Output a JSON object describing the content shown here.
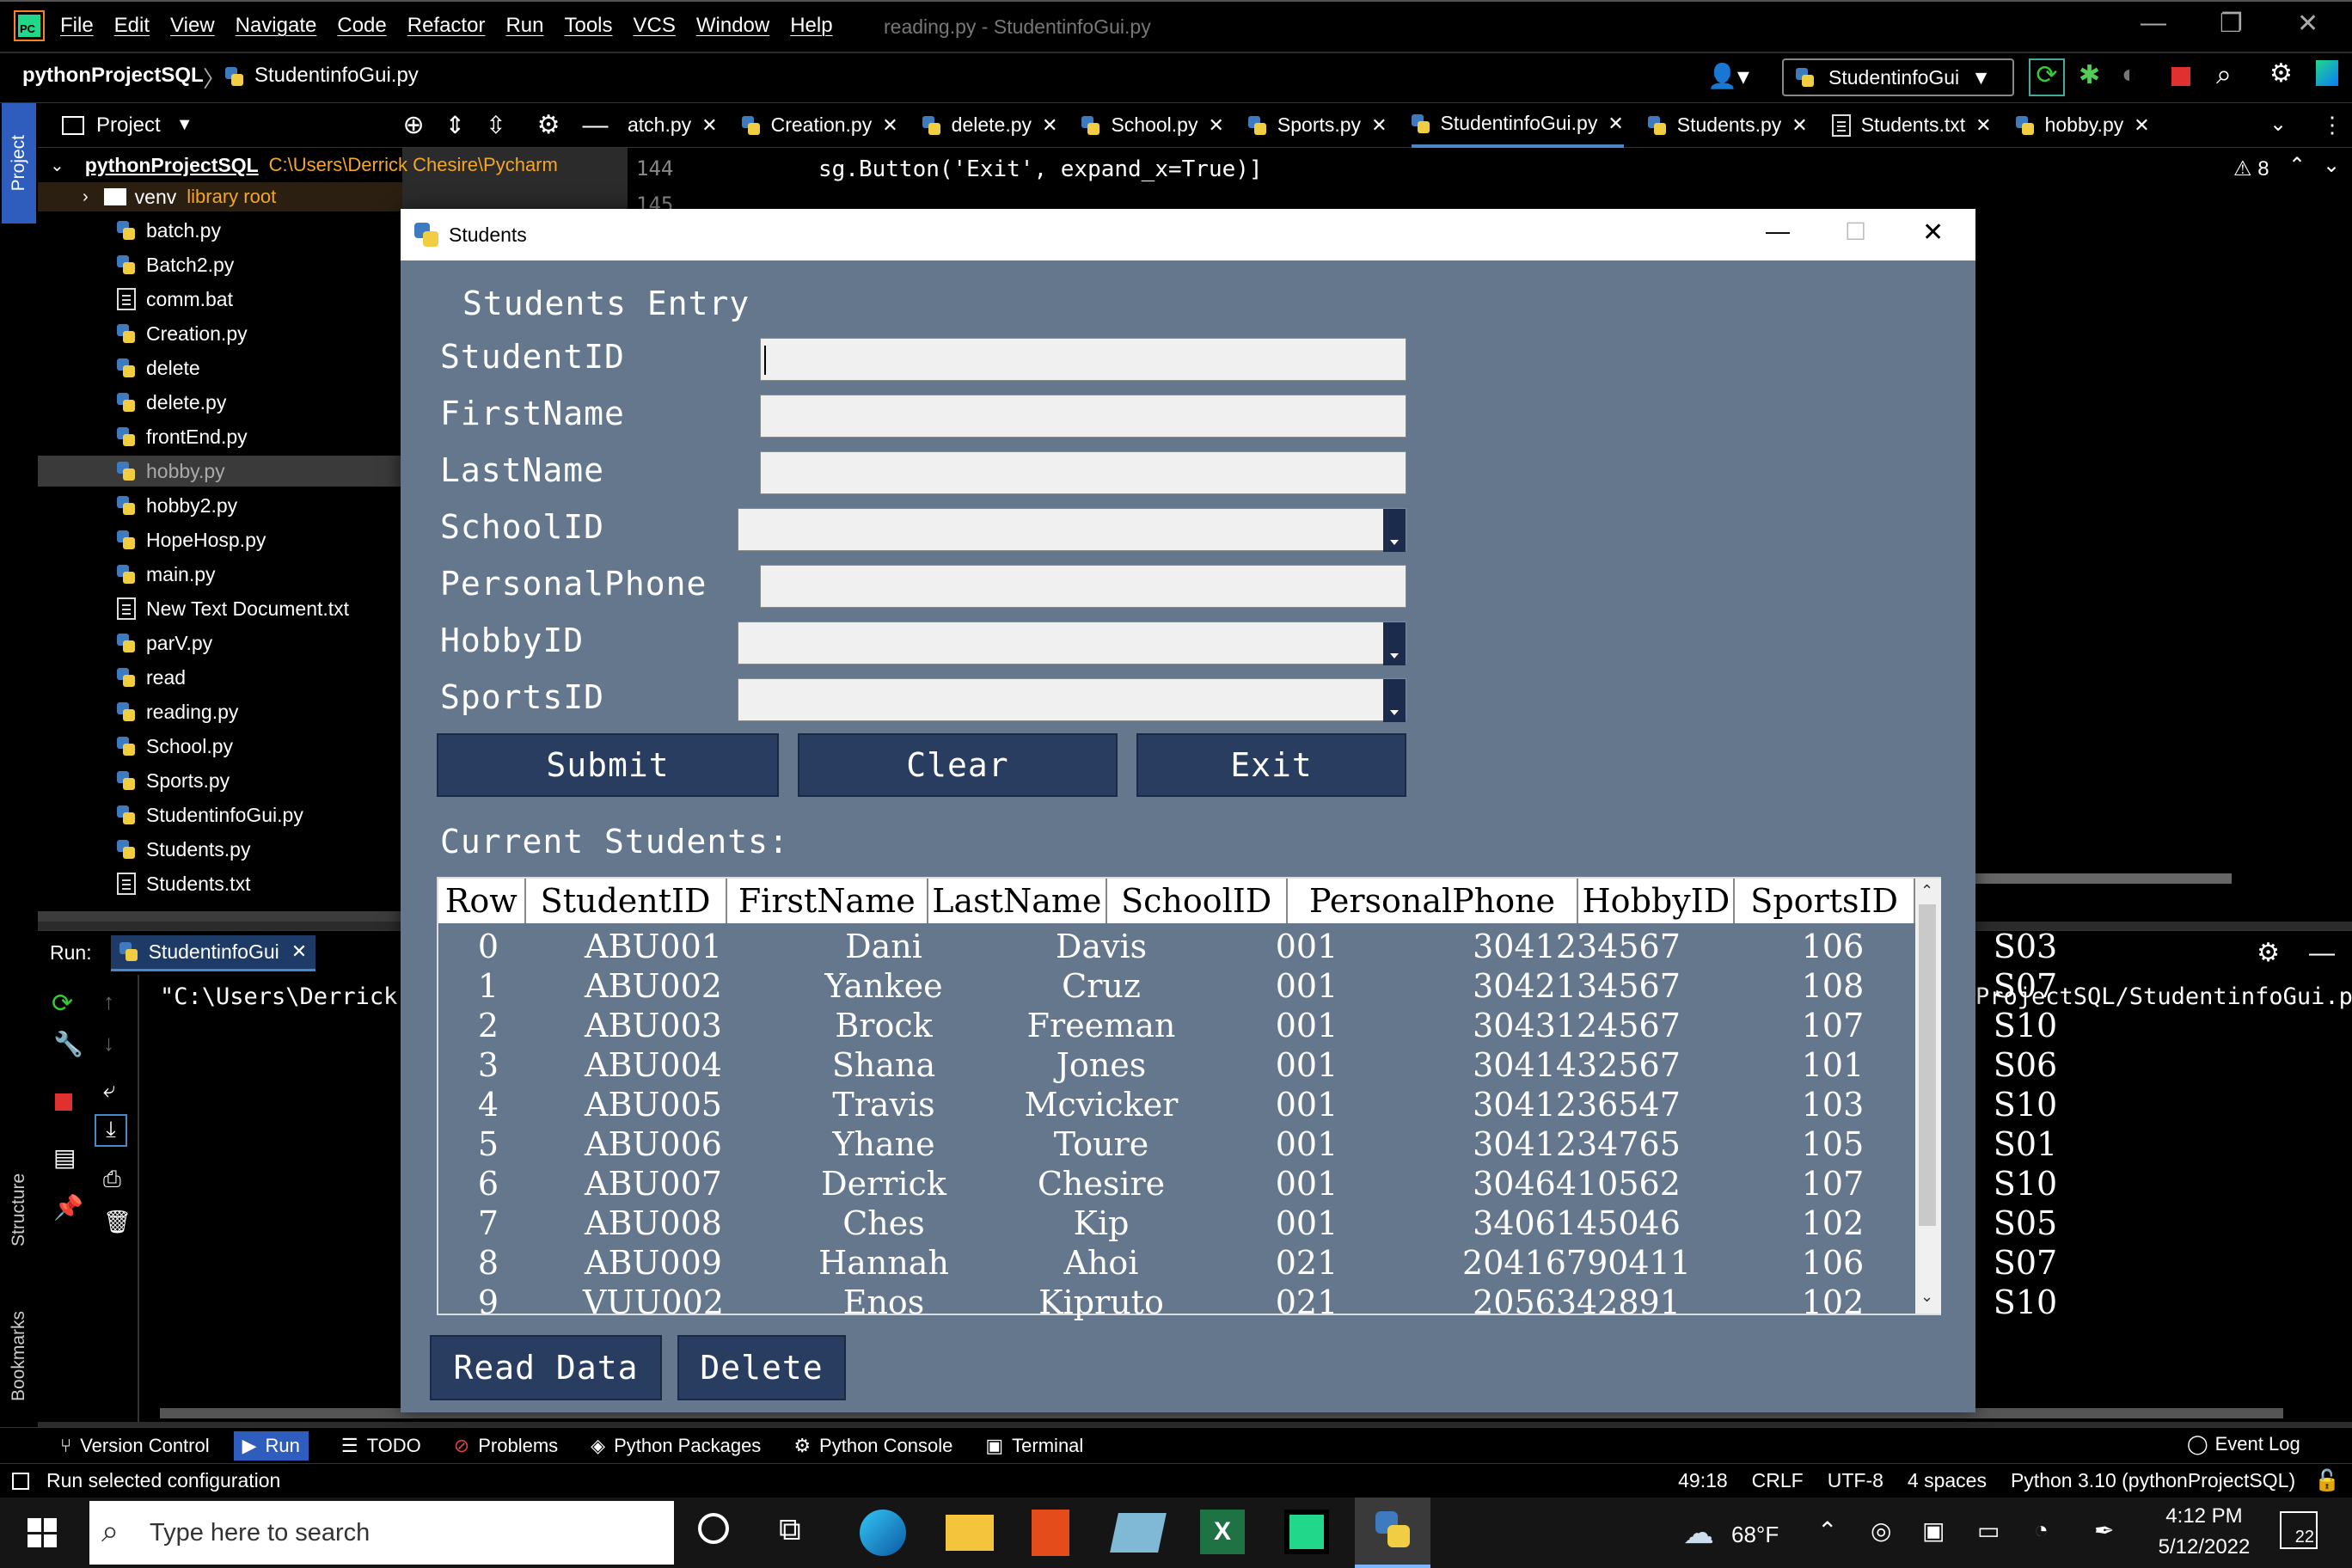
{
  "app": {
    "menu": [
      "File",
      "Edit",
      "View",
      "Navigate",
      "Code",
      "Refactor",
      "Run",
      "Tools",
      "VCS",
      "Window",
      "Help"
    ],
    "window_title": "reading.py - StudentinfoGui.py",
    "logo_text": "PC"
  },
  "navbar": {
    "project": "pythonProjectSQL",
    "file": "StudentinfoGui.py",
    "run_config": "StudentinfoGui"
  },
  "project_panel": {
    "title": "Project",
    "root_name": "pythonProjectSQL",
    "root_path": "C:\\Users\\Derrick Chesire\\Pycharm",
    "venv": "venv",
    "venv_note": "library root",
    "files": [
      "batch.py",
      "Batch2.py",
      "comm.bat",
      "Creation.py",
      "delete",
      "delete.py",
      "frontEnd.py",
      "hobby.py",
      "hobby2.py",
      "HopeHosp.py",
      "main.py",
      "New Text Document.txt",
      "parV.py",
      "read",
      "reading.py",
      "School.py",
      "Sports.py",
      "StudentinfoGui.py",
      "Students.py",
      "Students.txt"
    ]
  },
  "tabs": [
    "atch.py",
    "Creation.py",
    "delete.py",
    "School.py",
    "Sports.py",
    "StudentinfoGui.py",
    "Students.py",
    "Students.txt",
    "hobby.py"
  ],
  "editor": {
    "line_no": "144",
    "line_no2": "145",
    "code": "sg.Button('Exit', expand_x=True)]",
    "warnings": "8"
  },
  "run_panel": {
    "label": "Run:",
    "tab": "StudentinfoGui",
    "output_left": "\"C:\\Users\\Derrick",
    "output_right": "ProjectSQL/StudentinfoGui.py"
  },
  "left_strip": {
    "project": "Project",
    "structure": "Structure",
    "bookmarks": "Bookmarks"
  },
  "tool_windows": [
    "Version Control",
    "Run",
    "TODO",
    "Problems",
    "Python Packages",
    "Python Console",
    "Terminal"
  ],
  "event_log": "Event Log",
  "status": {
    "message": "Run selected configuration",
    "position": "49:18",
    "line_sep": "CRLF",
    "encoding": "UTF-8",
    "indent": "4 spaces",
    "interpreter": "Python 3.10 (pythonProjectSQL)"
  },
  "taskbar": {
    "search_placeholder": "Type here to search",
    "weather": "68°F",
    "time": "4:12 PM",
    "date": "5/12/2022",
    "notifications": "22"
  },
  "students_window": {
    "title": "Students",
    "heading": "Students Entry",
    "labels": {
      "student_id": "StudentID",
      "first_name": "FirstName",
      "last_name": "LastName",
      "school_id": "SchoolID",
      "personal_phone": "PersonalPhone",
      "hobby_id": "HobbyID",
      "sports_id": "SportsID"
    },
    "buttons": {
      "submit": "Submit",
      "clear": "Clear",
      "exit": "Exit",
      "read": "Read Data",
      "delete": "Delete"
    },
    "current_label": "Current Students:",
    "columns": [
      "Row",
      "StudentID",
      "FirstName",
      "LastName",
      "SchoolID",
      "PersonalPhone",
      "HobbyID",
      "SportsID"
    ],
    "rows": [
      [
        "0",
        "ABU001",
        "Dani",
        "Davis",
        "001",
        "3041234567",
        "106",
        "S03"
      ],
      [
        "1",
        "ABU002",
        "Yankee",
        "Cruz",
        "001",
        "3042134567",
        "108",
        "S07"
      ],
      [
        "2",
        "ABU003",
        "Brock",
        "Freeman",
        "001",
        "3043124567",
        "107",
        "S10"
      ],
      [
        "3",
        "ABU004",
        "Shana",
        "Jones",
        "001",
        "3041432567",
        "101",
        "S06"
      ],
      [
        "4",
        "ABU005",
        "Travis",
        "Mcvicker",
        "001",
        "3041236547",
        "103",
        "S10"
      ],
      [
        "5",
        "ABU006",
        "Yhane",
        "Toure",
        "001",
        "3041234765",
        "105",
        "S01"
      ],
      [
        "6",
        "ABU007",
        "Derrick",
        "Chesire",
        "001",
        "3046410562",
        "107",
        "S10"
      ],
      [
        "7",
        "ABU008",
        "Ches",
        "Kip",
        "001",
        "3406145046",
        "102",
        "S05"
      ],
      [
        "8",
        "ABU009",
        "Hannah",
        "Ahoi",
        "021",
        "20416790411",
        "106",
        "S07"
      ],
      [
        "9",
        "VUU002",
        "Enos",
        "Kipruto",
        "021",
        "2056342891",
        "102",
        "S10"
      ]
    ]
  }
}
